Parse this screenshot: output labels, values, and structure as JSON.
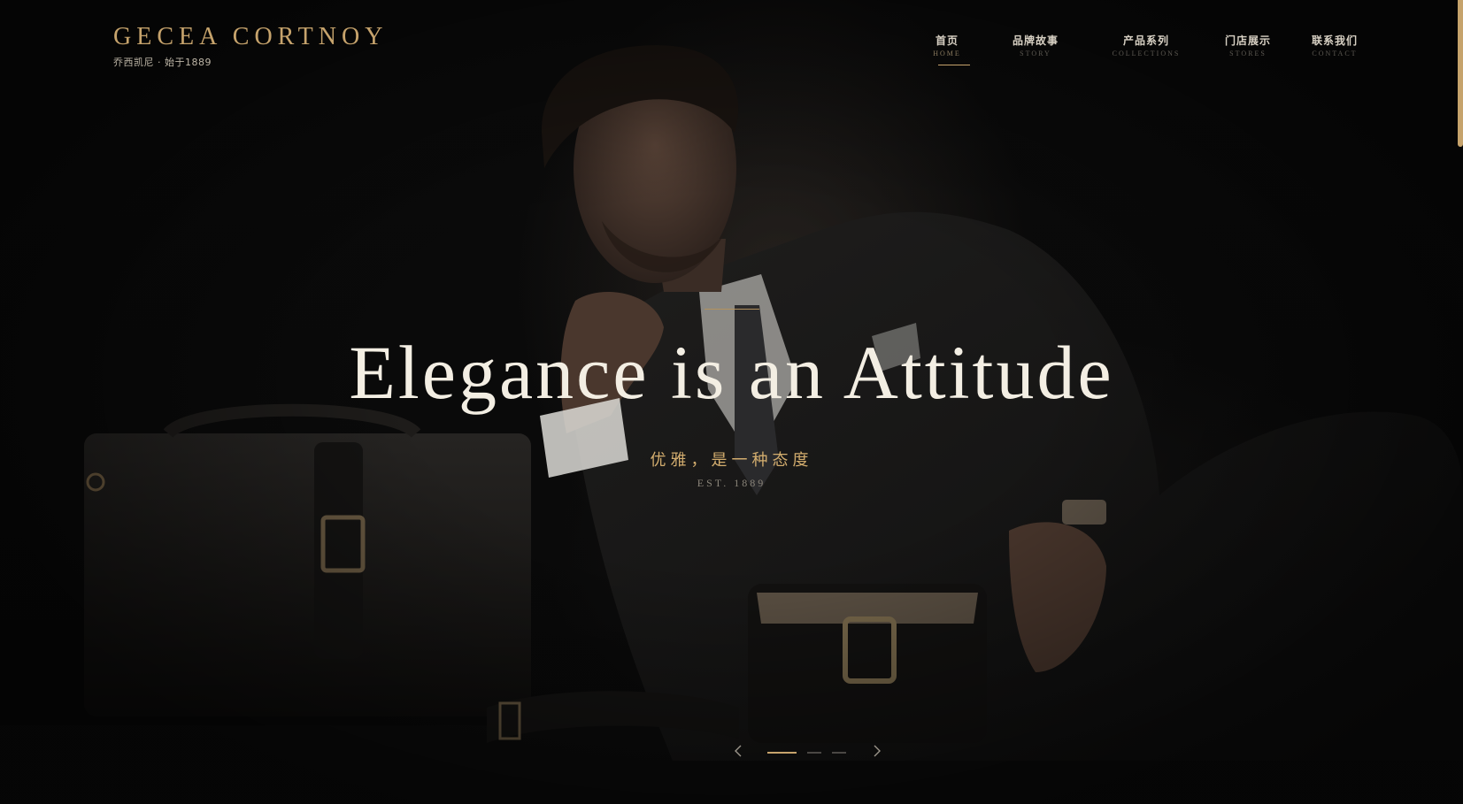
{
  "brand": {
    "name": "GECEA CORTNOY",
    "subtitle": "乔西凯尼 · 始于1889"
  },
  "nav": {
    "items": [
      {
        "cn": "首页",
        "en": "HOME",
        "active": true
      },
      {
        "cn": "品牌故事",
        "en": "STORY",
        "active": false
      },
      {
        "cn": "产品系列",
        "en": "COLLECTIONS",
        "active": false
      },
      {
        "cn": "门店展示",
        "en": "STORES",
        "active": false
      },
      {
        "cn": "联系我们",
        "en": "CONTACT",
        "active": false
      }
    ]
  },
  "hero": {
    "headline": "Elegance is an Attitude",
    "subtitle_cn": "优雅，是一种态度",
    "est": "EST. 1889"
  },
  "slider": {
    "total": 3,
    "current": 1
  },
  "colors": {
    "accent_gold": "#c6a36c",
    "background": "#080808",
    "headline": "#f3eee3"
  },
  "icons": {
    "prev": "chevron-left-icon",
    "next": "chevron-right-icon"
  }
}
